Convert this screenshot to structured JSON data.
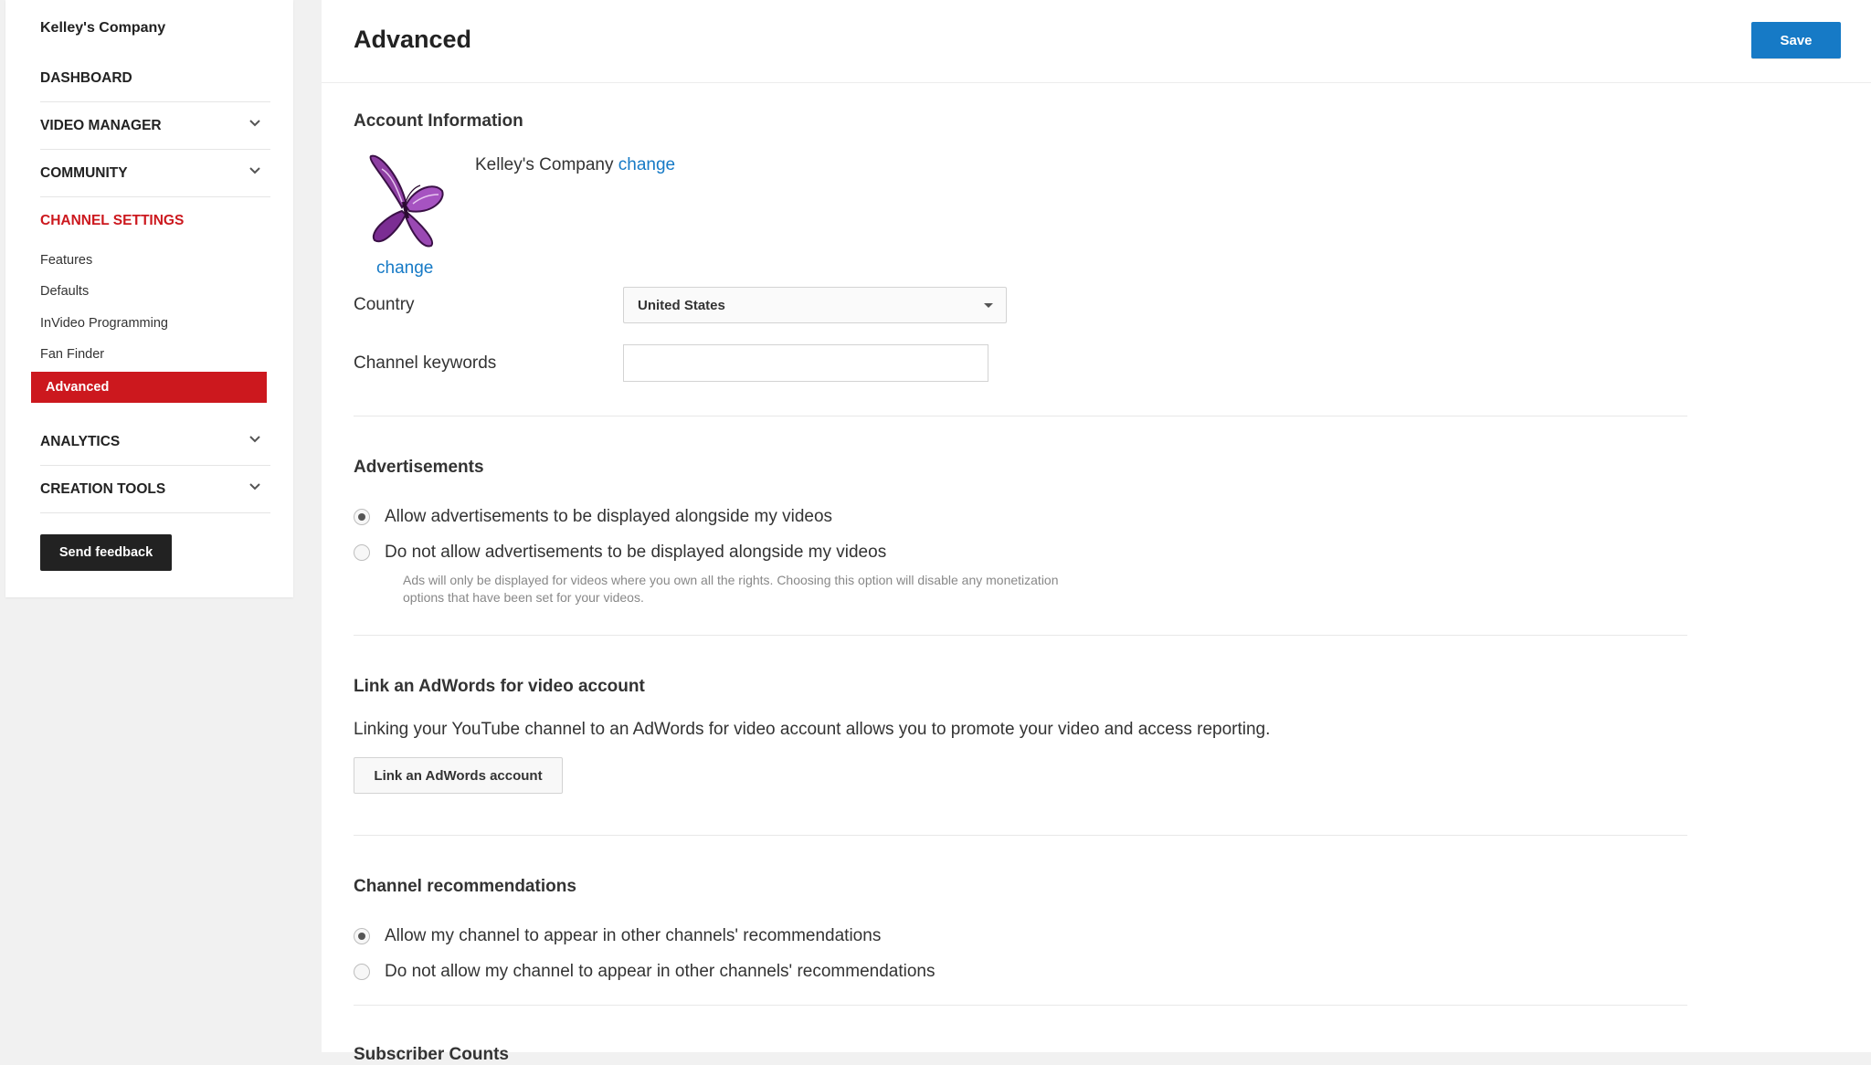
{
  "sidebar": {
    "company": "Kelley's Company",
    "dashboard": "DASHBOARD",
    "video_manager": "VIDEO MANAGER",
    "community": "COMMUNITY",
    "channel_settings": "CHANNEL SETTINGS",
    "sub_items": [
      "Features",
      "Defaults",
      "InVideo Programming",
      "Fan Finder",
      "Advanced"
    ],
    "analytics": "ANALYTICS",
    "creation_tools": "CREATION TOOLS",
    "send_feedback": "Send feedback"
  },
  "header": {
    "title": "Advanced",
    "save": "Save"
  },
  "account": {
    "section_title": "Account Information",
    "name": "Kelley's Company",
    "change_name": "change",
    "change_avatar": "change",
    "country_label": "Country",
    "country_value": "United States",
    "keywords_label": "Channel keywords",
    "keywords_value": ""
  },
  "ads": {
    "section_title": "Advertisements",
    "allow": "Allow advertisements to be displayed alongside my videos",
    "disallow": "Do not allow advertisements to be displayed alongside my videos",
    "note_line1": "Ads will only be displayed for videos where you own all the rights. Choosing this option will disable any monetization",
    "note_line2": "options that have been set for your videos.",
    "selected": "allow"
  },
  "adwords": {
    "section_title": "Link an AdWords for video account",
    "description": "Linking your YouTube channel to an AdWords for video account allows you to promote your video and access reporting.",
    "button": "Link an AdWords account"
  },
  "recommendations": {
    "section_title": "Channel recommendations",
    "allow": "Allow my channel to appear in other channels' recommendations",
    "disallow": "Do not allow my channel to appear in other channels' recommendations",
    "selected": "allow"
  },
  "next_section_title": "Subscriber Counts",
  "colors": {
    "accent_red": "#cc181e",
    "link_blue": "#167ac6",
    "avatar_purple": "#8e3fa3"
  },
  "icons": [
    "chevron-down-icon",
    "butterfly-avatar",
    "dropdown-caret-icon"
  ]
}
